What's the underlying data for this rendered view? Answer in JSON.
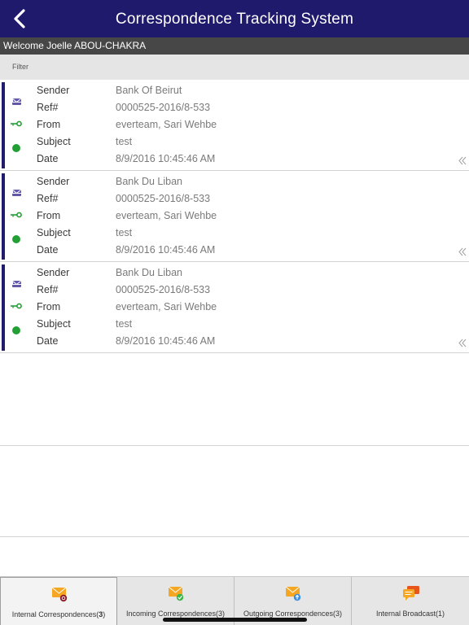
{
  "header": {
    "title": "Correspondence Tracking System",
    "back_icon": "chevron-left-icon"
  },
  "welcome": {
    "text": "Welcome Joelle  ABOU-CHAKRA"
  },
  "filter": {
    "label": "Filter"
  },
  "field_labels": {
    "sender": "Sender",
    "ref": "Ref#",
    "from": "From",
    "subject": "Subject",
    "date": "Date"
  },
  "items": [
    {
      "sender": "Bank Of Beirut",
      "ref": "0000525-2016/8-533",
      "from": "everteam, Sari Wehbe",
      "subject": "test",
      "date": "8/9/2016 10:45:46 AM"
    },
    {
      "sender": "Bank Du Liban",
      "ref": "0000525-2016/8-533",
      "from": "everteam, Sari Wehbe",
      "subject": "test",
      "date": "8/9/2016 10:45:46 AM"
    },
    {
      "sender": "Bank Du Liban",
      "ref": "0000525-2016/8-533",
      "from": "everteam, Sari Wehbe",
      "subject": "test",
      "date": "8/9/2016 10:45:46 AM"
    }
  ],
  "tabs": [
    {
      "label": "Internal Correspondences(",
      "count": "3",
      "suffix": ")",
      "icon": "internal-mail-icon",
      "active": true
    },
    {
      "label": "Incoming Correspondences(3)",
      "icon": "incoming-mail-icon",
      "active": false
    },
    {
      "label": "Outgoing Correspondences(3)",
      "icon": "outgoing-mail-icon",
      "active": false
    },
    {
      "label": "Internal Broadcast(1)",
      "icon": "broadcast-chat-icon",
      "active": false
    }
  ],
  "colors": {
    "header_bg": "#1f1a6b",
    "welcome_bg": "#474747",
    "accent_bar": "#221c6e",
    "status_green": "#22a036",
    "mail_purple": "#6258a8",
    "tab_icon_orange": "#f5a623"
  }
}
